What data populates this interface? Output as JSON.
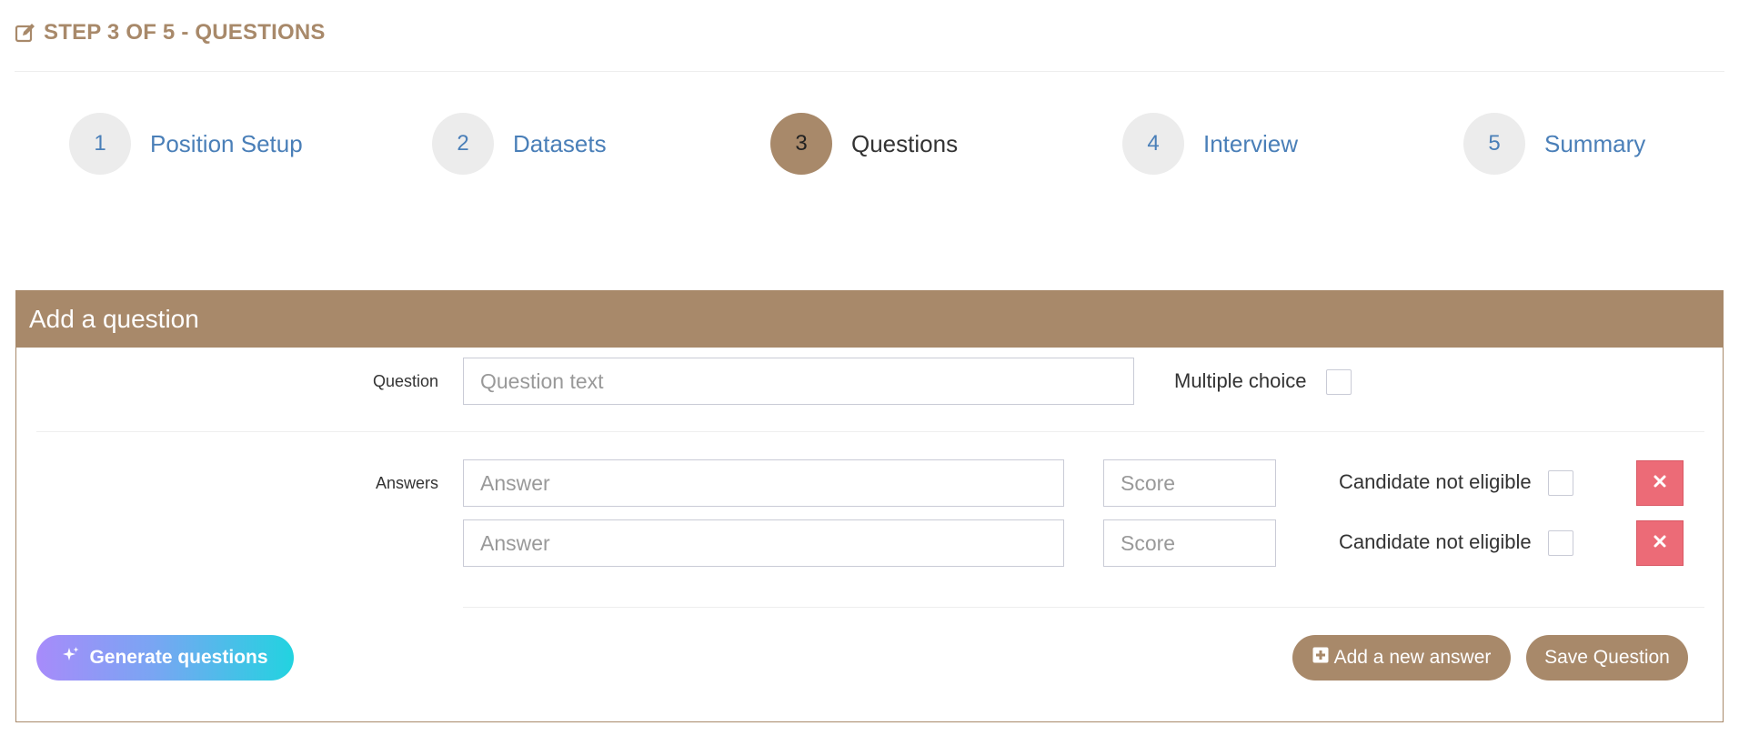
{
  "header": {
    "title": "STEP 3 OF 5 - QUESTIONS",
    "icon": "edit-icon"
  },
  "stepper": {
    "steps": [
      {
        "number": "1",
        "label": "Position Setup",
        "active": false
      },
      {
        "number": "2",
        "label": "Datasets",
        "active": false
      },
      {
        "number": "3",
        "label": "Questions",
        "active": true
      },
      {
        "number": "4",
        "label": "Interview",
        "active": false
      },
      {
        "number": "5",
        "label": "Summary",
        "active": false
      }
    ]
  },
  "card": {
    "title": "Add a question",
    "question_label": "Question",
    "question_placeholder": "Question text",
    "question_value": "",
    "multiple_choice_label": "Multiple choice",
    "multiple_choice_checked": false,
    "answers_label": "Answers",
    "answers": [
      {
        "answer_placeholder": "Answer",
        "answer_value": "",
        "score_placeholder": "Score",
        "score_value": "",
        "not_eligible_label": "Candidate not eligible",
        "not_eligible_checked": false
      },
      {
        "answer_placeholder": "Answer",
        "answer_value": "",
        "score_placeholder": "Score",
        "score_value": "",
        "not_eligible_label": "Candidate not eligible",
        "not_eligible_checked": false
      }
    ],
    "generate_label": "Generate questions",
    "add_answer_label": "Add a new answer",
    "save_label": "Save Question"
  },
  "colors": {
    "brand": "#a8896a",
    "link": "#4a7fb8",
    "danger": "#ec6b77",
    "gradient_start": "#a78bfa",
    "gradient_end": "#22d3e0"
  }
}
